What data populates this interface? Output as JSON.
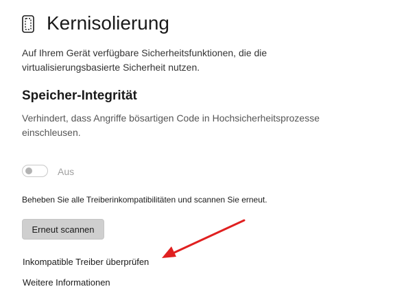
{
  "header": {
    "icon": "core-isolation-chip-icon",
    "title": "Kernisolierung",
    "description": "Auf Ihrem Gerät verfügbare Sicherheitsfunktionen, die die virtualisierungsbasierte Sicherheit nutzen."
  },
  "memory_integrity": {
    "title": "Speicher-Integrität",
    "description": "Verhindert, dass Angriffe bösartigen Code in Hochsicherheitsprozesse einschleusen.",
    "toggle_state": "off",
    "toggle_label": "Aus",
    "incompatibility_text": "Beheben Sie alle Treiberinkompatibilitäten und scannen Sie erneut.",
    "rescan_label": "Erneut scannen"
  },
  "links": {
    "review_drivers": "Inkompatible Treiber überprüfen",
    "more_info": "Weitere Informationen"
  },
  "annotation": {
    "type": "arrow",
    "color": "#e02020"
  }
}
